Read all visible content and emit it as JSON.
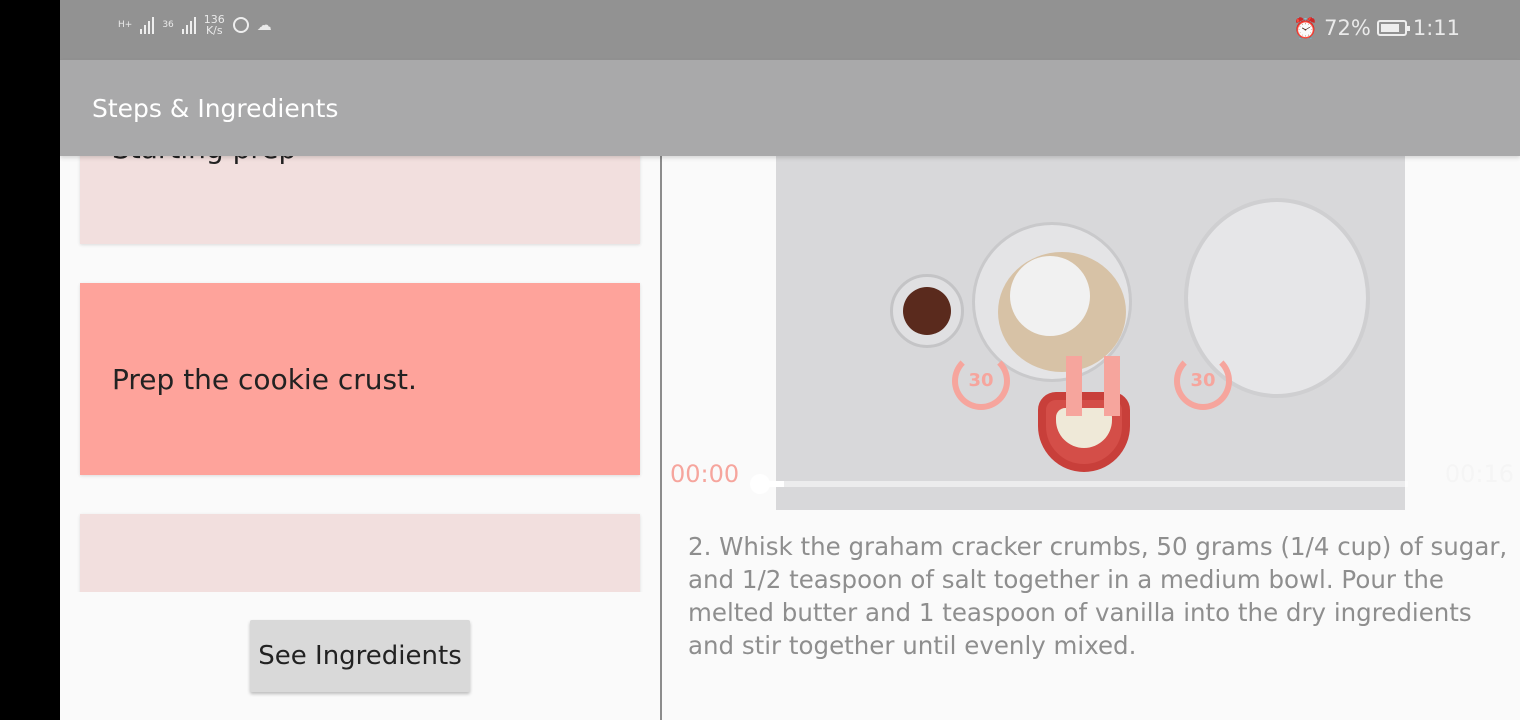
{
  "status_bar": {
    "net_label_1": "H+",
    "net_label_2": "36",
    "speed_value": "136",
    "speed_unit": "K/s",
    "battery": "72%",
    "time": "1:11"
  },
  "app_bar": {
    "title": "Steps & Ingredients"
  },
  "steps": [
    {
      "label": "Starting prep"
    },
    {
      "label": "Prep the cookie crust."
    },
    {
      "label": ""
    }
  ],
  "buttons": {
    "see_ingredients": "See Ingredients"
  },
  "player": {
    "current_time": "00:00",
    "total_time": "00:16",
    "rewind_seconds": "30",
    "forward_seconds": "30",
    "progress": 0.04
  },
  "step_description": "2. Whisk the graham cracker crumbs, 50 grams (1/4 cup) of sugar, and 1/2 teaspoon of salt together in a medium bowl. Pour the melted butter and 1 teaspoon of vanilla into the dry ingredients and stir together until evenly mixed.",
  "colors": {
    "selected_step": "#fea39b",
    "step_card": "#f2dfde",
    "player_accent": "#f6a59d",
    "app_bar": "#a9a9aa",
    "status_bar": "#929292"
  }
}
